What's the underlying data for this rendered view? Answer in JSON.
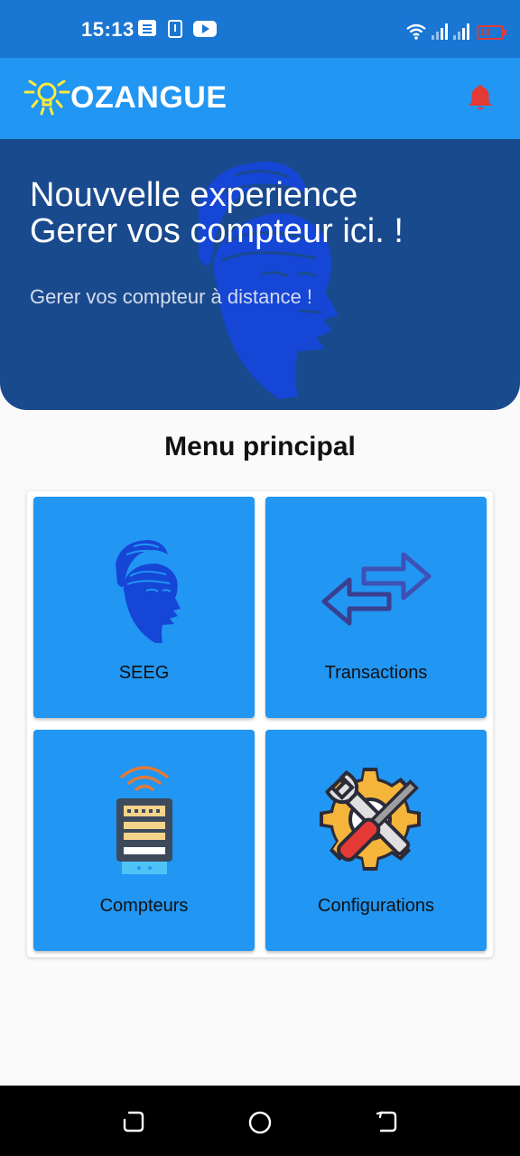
{
  "status_bar": {
    "time": "15:13",
    "battery_text": "13"
  },
  "app_bar": {
    "brand": "OZANGUE",
    "brand_color": "#2196f3",
    "notification_icon": "bell-icon",
    "notification_color": "#e53935"
  },
  "hero": {
    "title_line1": "Nouvvelle experience",
    "title_line2": "Gerer vos compteur ici. !",
    "subtitle": "Gerer vos compteur à distance !"
  },
  "menu": {
    "title": "Menu principal",
    "tiles": [
      {
        "label": "SEEG",
        "icon": "african-mask-icon"
      },
      {
        "label": "Transactions",
        "icon": "transfer-arrows-icon"
      },
      {
        "label": "Compteurs",
        "icon": "smart-meter-icon"
      },
      {
        "label": "Configurations",
        "icon": "gear-wrench-icon"
      }
    ]
  },
  "nav_bar": {
    "buttons": [
      "recent-apps-icon",
      "home-icon",
      "back-icon"
    ]
  }
}
